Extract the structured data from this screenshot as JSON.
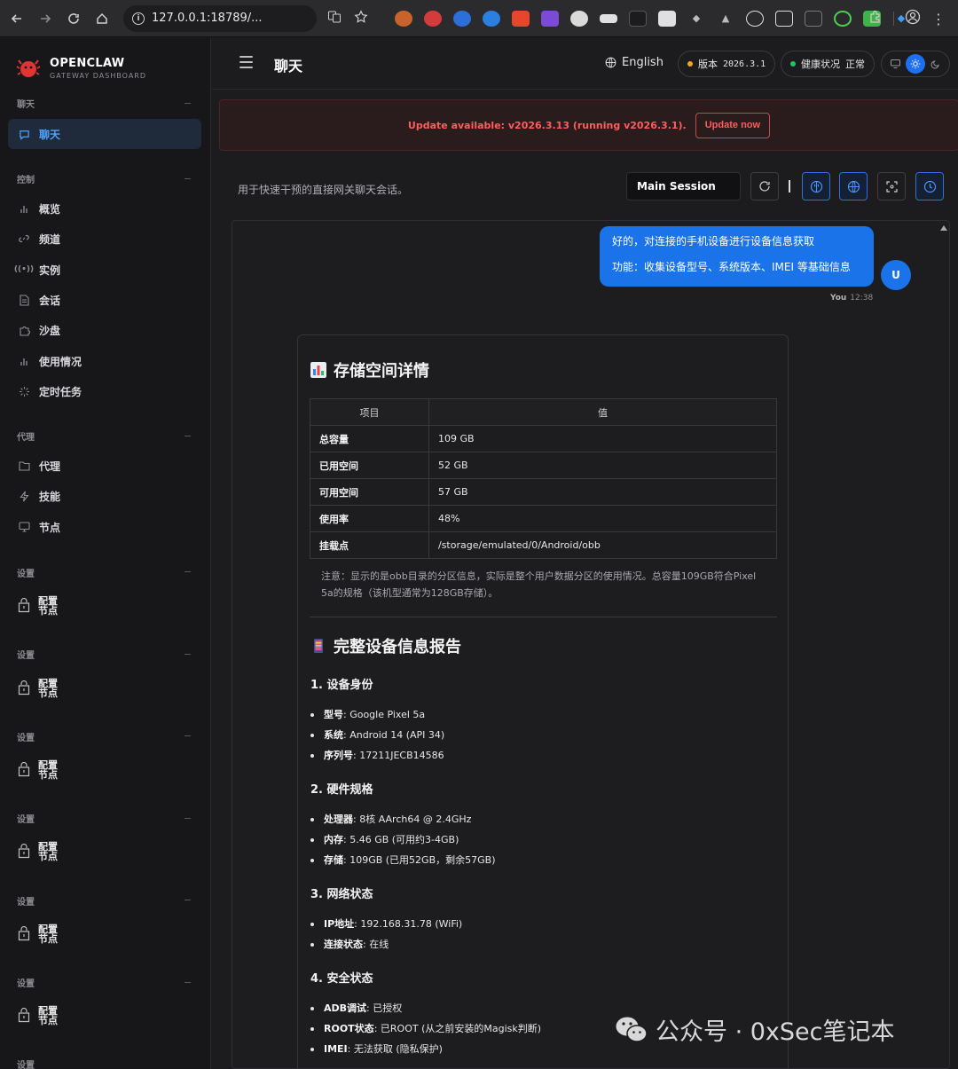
{
  "browser": {
    "url": "127.0.0.1:18789/...",
    "info_glyph": "i"
  },
  "sidebar": {
    "brand": {
      "title": "OPENCLAW",
      "subtitle": "GATEWAY DASHBOARD"
    },
    "sections": [
      {
        "label": "聊天"
      },
      {
        "label": "控制"
      },
      {
        "label": "代理"
      },
      {
        "label": "设置"
      },
      {
        "label": "设置"
      },
      {
        "label": "设置"
      },
      {
        "label": "设置"
      },
      {
        "label": "设置"
      },
      {
        "label": "设置"
      },
      {
        "label": "设置"
      }
    ],
    "items": [
      {
        "label": "聊天",
        "icon": "chat-icon",
        "active": true
      },
      {
        "label": "概览",
        "icon": "bar-chart-icon"
      },
      {
        "label": "频道",
        "icon": "link-icon"
      },
      {
        "label": "实例",
        "icon": "radio-icon"
      },
      {
        "label": "会话",
        "icon": "document-icon"
      },
      {
        "label": "沙盘",
        "icon": "puzzle-icon"
      },
      {
        "label": "使用情况",
        "icon": "bar-chart-icon"
      },
      {
        "label": "定时任务",
        "icon": "loader-icon"
      },
      {
        "label": "代理",
        "icon": "folder-icon"
      },
      {
        "label": "技能",
        "icon": "zap-icon"
      },
      {
        "label": "节点",
        "icon": "monitor-icon"
      }
    ],
    "config_items": [
      {
        "line1": "配置",
        "line2": "节点"
      },
      {
        "line1": "配置",
        "line2": "节点"
      },
      {
        "line1": "配置",
        "line2": "节点"
      },
      {
        "line1": "配置",
        "line2": "节点"
      },
      {
        "line1": "配置",
        "line2": "节点"
      },
      {
        "line1": "配置",
        "line2": "节点"
      }
    ]
  },
  "topbar": {
    "title": "聊天",
    "language": "English",
    "version_label": "版本",
    "version_value": "2026.3.1",
    "health_label": "健康状况",
    "health_value": "正常"
  },
  "banner": {
    "text": "Update available: v2026.3.13 (running v2026.3.1).",
    "button": "Update now"
  },
  "toolbar": {
    "subtitle": "用于快速干预的直接网关聊天会话。",
    "session": "Main Session"
  },
  "message": {
    "line1": "好的，对连接的手机设备进行设备信息获取",
    "line2": "功能：收集设备型号、系统版本、IMEI 等基础信息",
    "avatar": "U",
    "sender": "You",
    "time": "12:38"
  },
  "report": {
    "storage_title": "存储空间详情",
    "table_headers": [
      "项目",
      "值"
    ],
    "table_rows": [
      {
        "key": "总容量",
        "value": "109 GB"
      },
      {
        "key": "已用空间",
        "value": "52 GB"
      },
      {
        "key": "可用空间",
        "value": "57 GB"
      },
      {
        "key": "使用率",
        "value": "48%"
      },
      {
        "key": "挂载点",
        "value": "/storage/emulated/0/Android/obb"
      }
    ],
    "note": "注意：显示的是obb目录的分区信息，实际是整个用户数据分区的使用情况。总容量109GB符合Pixel 5a的规格（该机型通常为128GB存储）。",
    "device_title": "完整设备信息报告",
    "sections": [
      {
        "title": "1. 设备身份",
        "items": [
          {
            "k": "型号",
            "v": ": Google Pixel 5a"
          },
          {
            "k": "系统",
            "v": ": Android 14 (API 34)"
          },
          {
            "k": "序列号",
            "v": ": 17211JECB14586"
          }
        ]
      },
      {
        "title": "2. 硬件规格",
        "items": [
          {
            "k": "处理器",
            "v": ": 8核 AArch64 @ 2.4GHz"
          },
          {
            "k": "内存",
            "v": ": 5.46 GB (可用约3-4GB)"
          },
          {
            "k": "存储",
            "v": ": 109GB (已用52GB，剩余57GB)"
          }
        ]
      },
      {
        "title": "3. 网络状态",
        "items": [
          {
            "k": "IP地址",
            "v": ": 192.168.31.78 (WiFi)"
          },
          {
            "k": "连接状态",
            "v": ": 在线"
          }
        ]
      },
      {
        "title": "4. 安全状态",
        "items": [
          {
            "k": "ADB调试",
            "v": ": 已授权"
          },
          {
            "k": "ROOT状态",
            "v": ": 已ROOT (从之前安装的Magisk判断)"
          },
          {
            "k": "IMEI",
            "v": ": 无法获取 (隐私保护)"
          }
        ]
      }
    ]
  },
  "watermark": "公众号 · 0xSec笔记本",
  "colors": {
    "accent": "#1a73e8",
    "danger": "#ff5c5c",
    "version_dot": "#f5a623",
    "health_dot": "#22c55e"
  }
}
